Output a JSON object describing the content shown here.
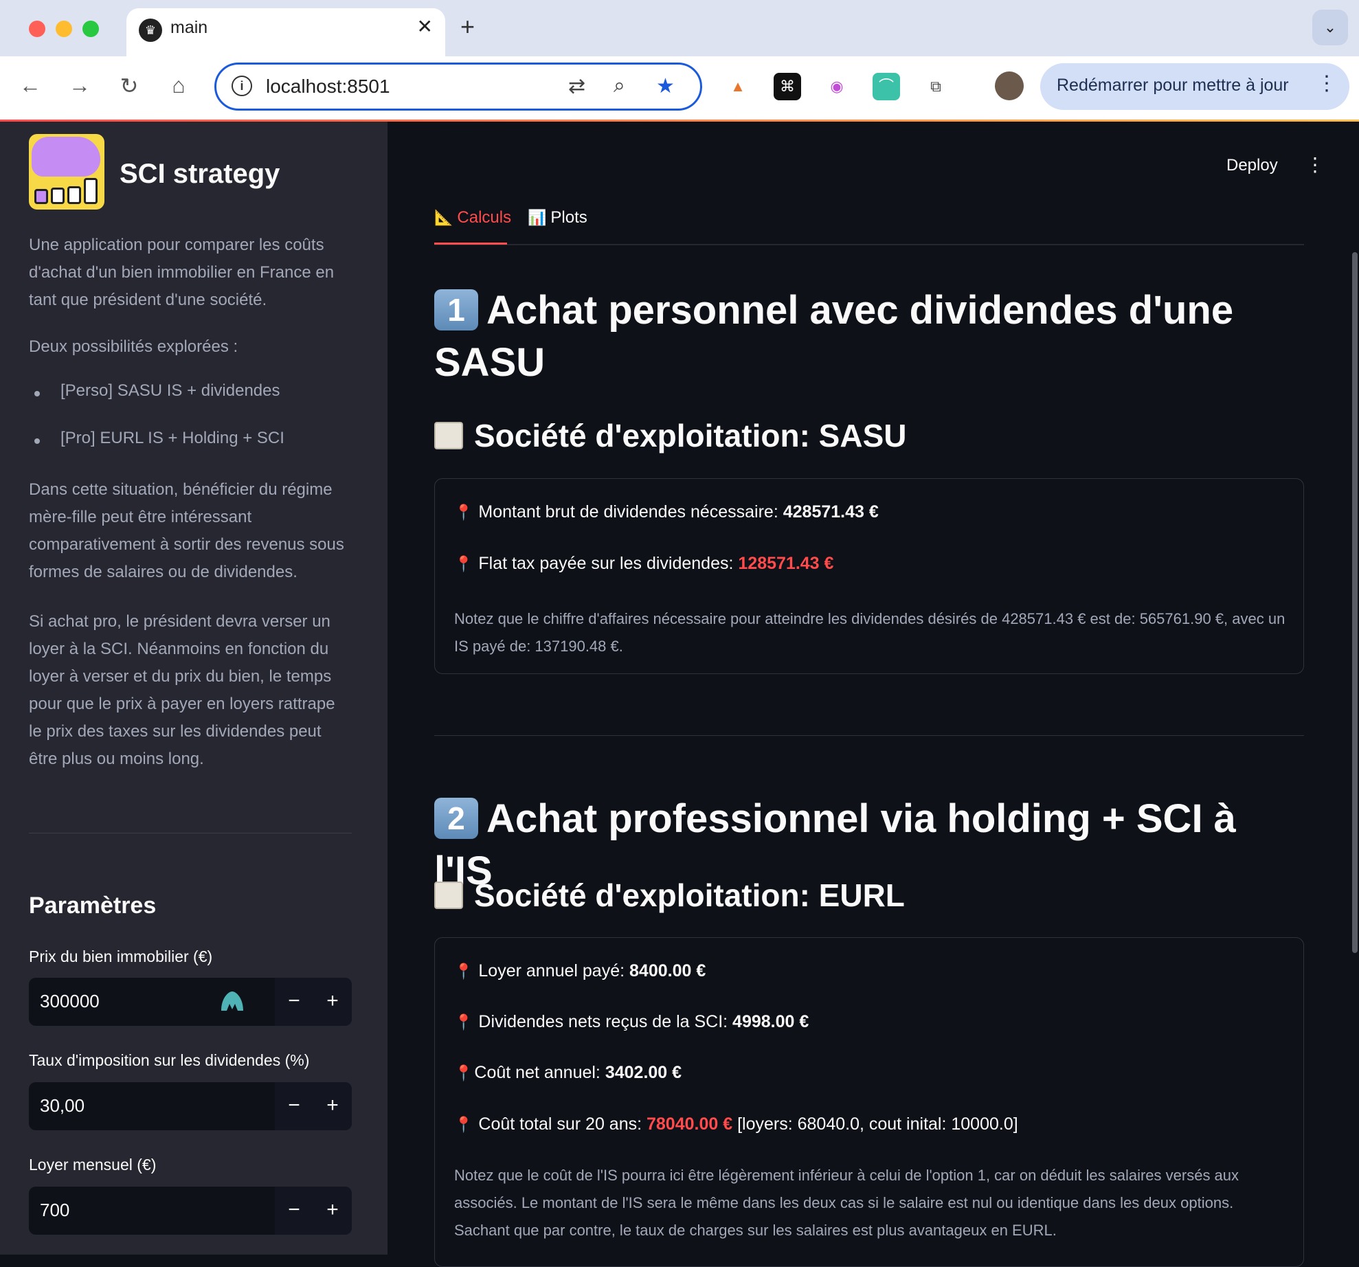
{
  "browser": {
    "tab_title": "main",
    "url": "localhost:8501",
    "update_button": "Redémarrer pour mettre à jour"
  },
  "sidebar": {
    "title": "SCI strategy",
    "intro": "Une application pour comparer les coûts d'achat d'un bien immobilier en France en tant que président d'une société.",
    "possibilities_label": "Deux possibilités explorées :",
    "possibilities": [
      "[Perso] SASU IS + dividendes",
      "[Pro] EURL IS + Holding + SCI"
    ],
    "paragraph1": "Dans cette situation, bénéficier du régime mère-fille peut être intéressant comparativement à sortir des revenus sous formes de salaires ou de dividendes.",
    "paragraph2": "Si achat pro, le président devra verser un loyer à la SCI. Néanmoins en fonction du loyer à verser et du prix du bien, le temps pour que le prix à payer en loyers rattrape le prix des taxes sur les dividendes peut être plus ou moins long.",
    "params_title": "Paramètres",
    "fields": [
      {
        "label": "Prix du bien immobilier (€)",
        "value": "300000"
      },
      {
        "label": "Taux d'imposition sur les dividendes (%)",
        "value": "30,00"
      },
      {
        "label": "Loyer mensuel (€)",
        "value": "700"
      }
    ],
    "minus": "−",
    "plus": "+"
  },
  "header": {
    "deploy": "Deploy",
    "menu": "⋮"
  },
  "tabs": [
    {
      "icon": "📐",
      "label": "Calculs"
    },
    {
      "icon": "📊",
      "label": "Plots"
    }
  ],
  "section1": {
    "number": "1",
    "title": "Achat personnel avec dividendes d'une SASU",
    "subtitle": "Société d'exploitation: SASU",
    "line1_label": "Montant brut de dividendes nécessaire:",
    "line1_value": "428571.43 €",
    "line2_label": "Flat tax payée sur les dividendes:",
    "line2_value": "128571.43 €",
    "note": "Notez que le chiffre d'affaires nécessaire pour atteindre les dividendes désirés de 428571.43 € est de: 565761.90 €, avec un IS payé de: 137190.48 €."
  },
  "section2": {
    "number": "2",
    "title": "Achat professionnel via holding + SCI à l'IS",
    "subtitle": "Société d'exploitation: EURL",
    "line1_label": "Loyer annuel payé:",
    "line1_value": "8400.00 €",
    "line2_label": "Dividendes nets reçus de la SCI:",
    "line2_value": "4998.00 €",
    "line3_label": "Coût net annuel:",
    "line3_value": "3402.00 €",
    "line4_label": "Coût total sur 20 ans:",
    "line4_value": "78040.00 €",
    "line4_extra": "[loyers: 68040.0, cout inital: 10000.0]",
    "note": "Notez que le coût de l'IS pourra ici être légèrement inférieur à celui de l'option 1, car on déduit les salaires versés aux associés. Le montant de l'IS sera le même dans les deux cas si le salaire est nul ou identique dans les deux options. Sachant que par contre, le taux de charges sur les salaires est plus avantageux en EURL."
  }
}
